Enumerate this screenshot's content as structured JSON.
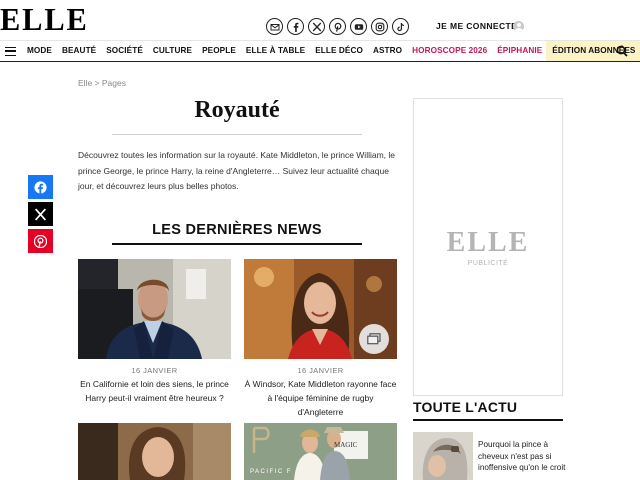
{
  "header": {
    "logo": "ELLE",
    "social_icons": [
      "newsletter-icon",
      "facebook-icon",
      "x-icon",
      "pinterest-icon",
      "youtube-icon",
      "instagram-icon",
      "tiktok-icon"
    ],
    "login_label": "JE ME CONNECTE"
  },
  "nav": {
    "items": [
      "MODE",
      "BEAUTÉ",
      "SOCIÉTÉ",
      "CULTURE",
      "PEOPLE",
      "ELLE À TABLE",
      "ELLE DÉCO",
      "ASTRO",
      "HOROSCOPE 2026",
      "ÉPIPHANIE",
      "ÉDITION ABONNÉES"
    ],
    "highlight_color": "#c2185b",
    "subscriber_bg": "#fbf3c6"
  },
  "breadcrumb": "Elle > Pages",
  "page": {
    "title": "Royauté",
    "intro": "Découvrez toutes les information sur la royauté. Kate Middleton, le prince William, le prince George, le prince Harry, la reine d'Angleterre… Suivez leur actualité chaque jour, et découvrez leurs plus belles photos."
  },
  "share": [
    "facebook-icon",
    "x-icon",
    "pinterest-icon"
  ],
  "news": {
    "heading": "LES DERNIÈRES NEWS",
    "articles": [
      {
        "date": "16 JANVIER",
        "title": "En Californie et loin des siens, le prince Harry peut-il vraiment être heureux ?"
      },
      {
        "date": "16 JANVIER",
        "title": "À Windsor, Kate Middleton rayonne face à l'équipe féminine de rugby d'Angleterre"
      },
      {
        "date": "",
        "title": ""
      },
      {
        "date": "",
        "title": ""
      }
    ],
    "photo_sign_text": "PACIFIC F",
    "photo_sign_text2": "MAGIC"
  },
  "sidebar": {
    "ad_logo": "ELLE",
    "ad_label": "PUBLICITÉ",
    "actu_heading": "TOUTE L'ACTU",
    "actu_item": "Pourquoi la pince à cheveux n'est pas si inoffensive qu'on le croit"
  },
  "colors": {
    "facebook": "#1877f2",
    "x": "#000000",
    "pinterest": "#e60023"
  }
}
